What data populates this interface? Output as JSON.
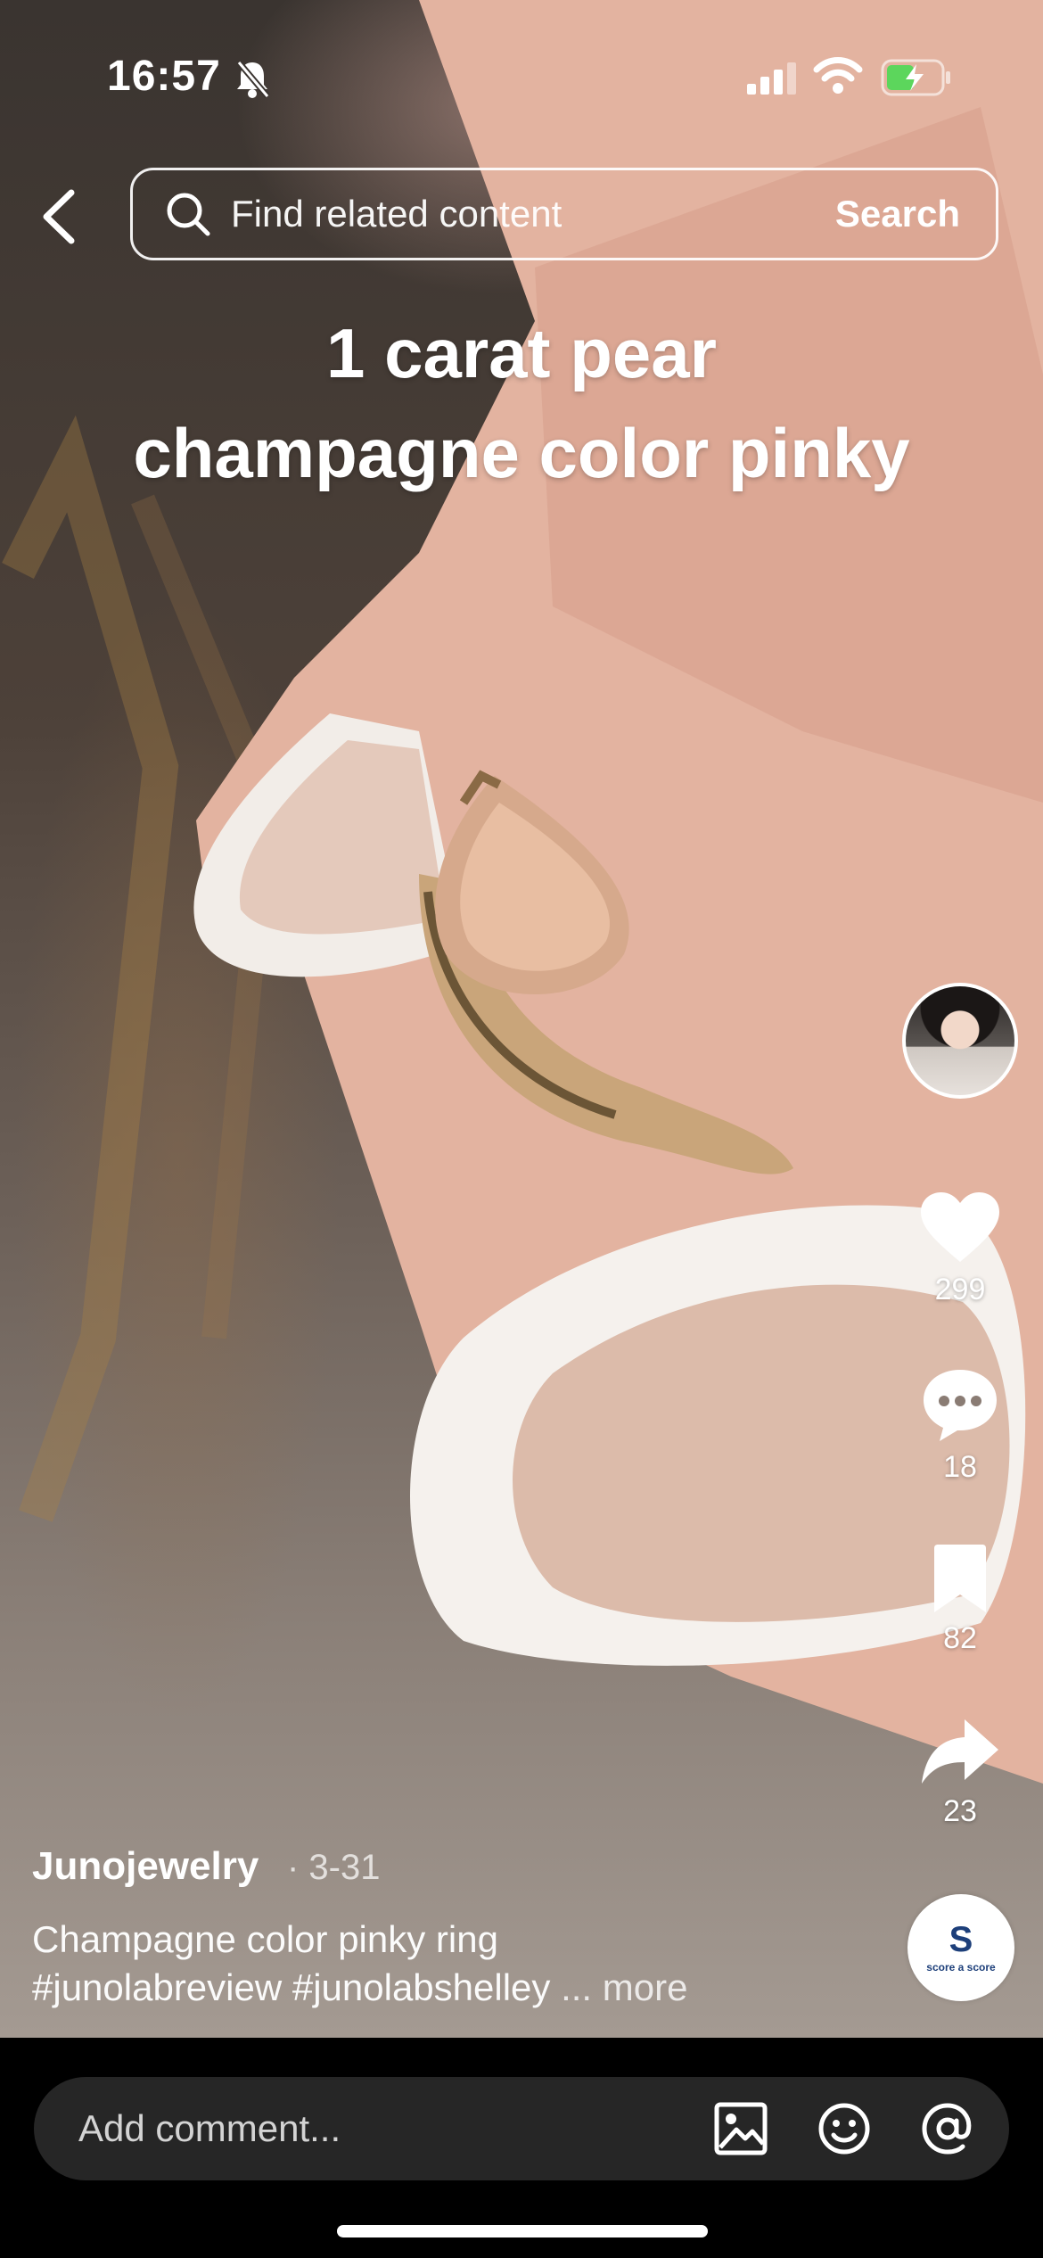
{
  "status_bar": {
    "time": "16:57",
    "icons": [
      "bell-slash-icon",
      "signal-icon",
      "wifi-icon",
      "battery-charging-icon"
    ]
  },
  "search": {
    "placeholder": "Find related content",
    "button_label": "Search",
    "icon": "search-icon",
    "back_icon": "back-icon"
  },
  "video": {
    "overlay_line1": "1 carat pear",
    "overlay_line2": "champagne color pinky"
  },
  "actions": {
    "like_count": "299",
    "comment_count": "18",
    "save_count": "82",
    "share_count": "23",
    "music_label": "score a score"
  },
  "post": {
    "author": "Junojewelry",
    "date": "· 3-31",
    "caption_line1": "Champagne color pinky ring",
    "caption_line2": "#junolabreview #junolabshelley",
    "more_label": "... more"
  },
  "comment_bar": {
    "placeholder": "Add comment...",
    "icons": [
      "image-icon",
      "emoji-icon",
      "mention-icon"
    ]
  },
  "colors": {
    "background": "#000000",
    "comment_box": "#262626",
    "text": "#ffffff"
  }
}
